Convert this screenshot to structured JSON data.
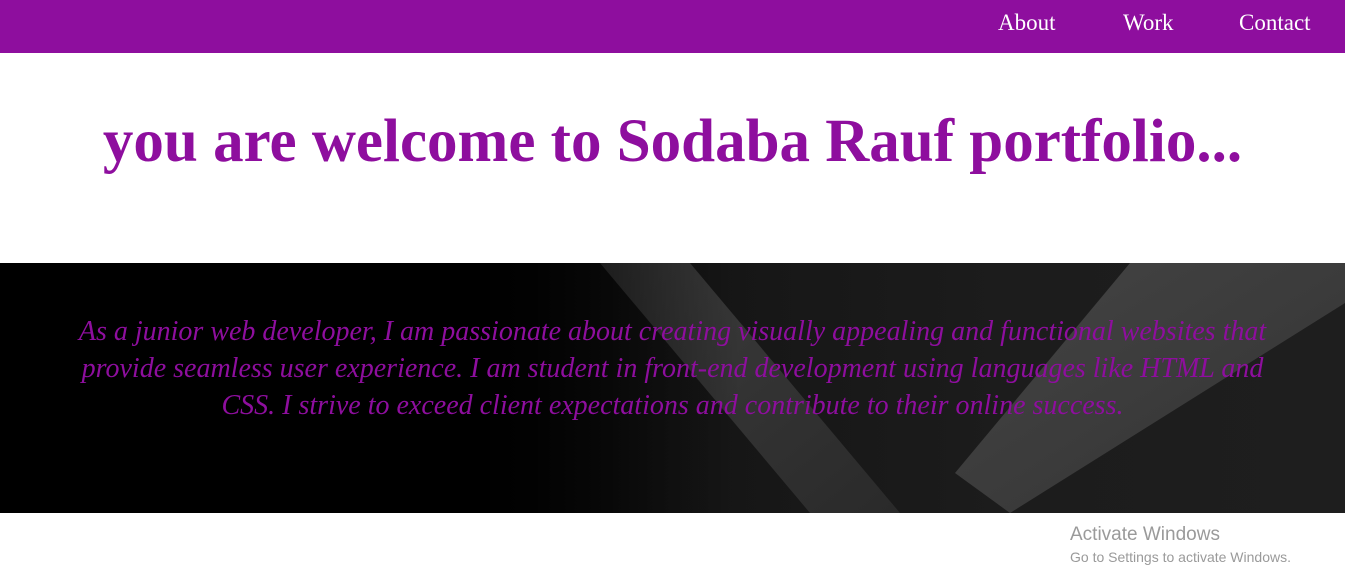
{
  "nav": {
    "links": [
      {
        "label": "About"
      },
      {
        "label": "Work"
      },
      {
        "label": "Contact"
      }
    ]
  },
  "hero": {
    "title": "you are welcome to Sodaba Rauf portfolio..."
  },
  "about": {
    "text": "As a junior web developer, I am passionate about creating visually appealing and functional websites that provide seamless user experience. I am student in front-end development using languages like HTML and CSS. I strive to exceed client expectations and contribute to their online success."
  },
  "watermark": {
    "title": "Activate Windows",
    "subtitle": "Go to Settings to activate Windows."
  },
  "colors": {
    "brand_purple": "#8e0e9e",
    "nav_text": "#ffffff",
    "about_background": "#000000",
    "watermark_text": "#9a9a9a"
  }
}
